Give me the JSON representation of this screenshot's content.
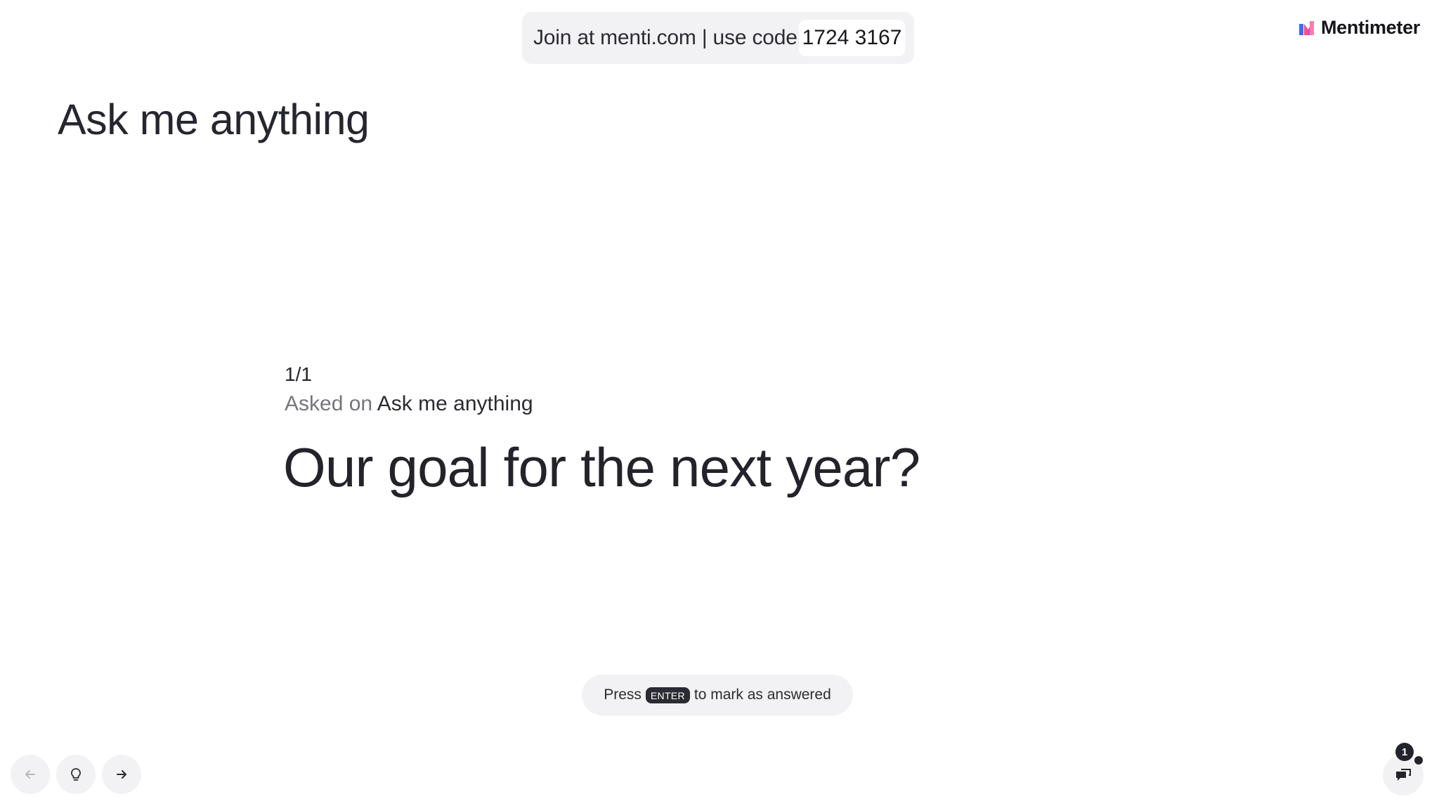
{
  "join": {
    "text": "Join at menti.com | use code",
    "code": "1724 3167"
  },
  "brand": {
    "name": "Mentimeter",
    "logo_icon": "mentimeter-logo-icon",
    "colors": [
      "#3f6bff",
      "#ff4f87",
      "#ff7ab0"
    ]
  },
  "slide": {
    "title": "Ask me anything"
  },
  "question": {
    "counter": "1/1",
    "asked_prefix": "Asked on",
    "asked_slide": "Ask me anything",
    "text": "Our goal for the next year?"
  },
  "hint": {
    "before": "Press",
    "key": "ENTER",
    "after": "to mark as answered"
  },
  "controls": {
    "prev_icon": "arrow-left-icon",
    "hint_icon": "lightbulb-icon",
    "next_icon": "arrow-right-icon",
    "qa_icon": "chat-bubbles-icon",
    "qa_count": "1"
  }
}
